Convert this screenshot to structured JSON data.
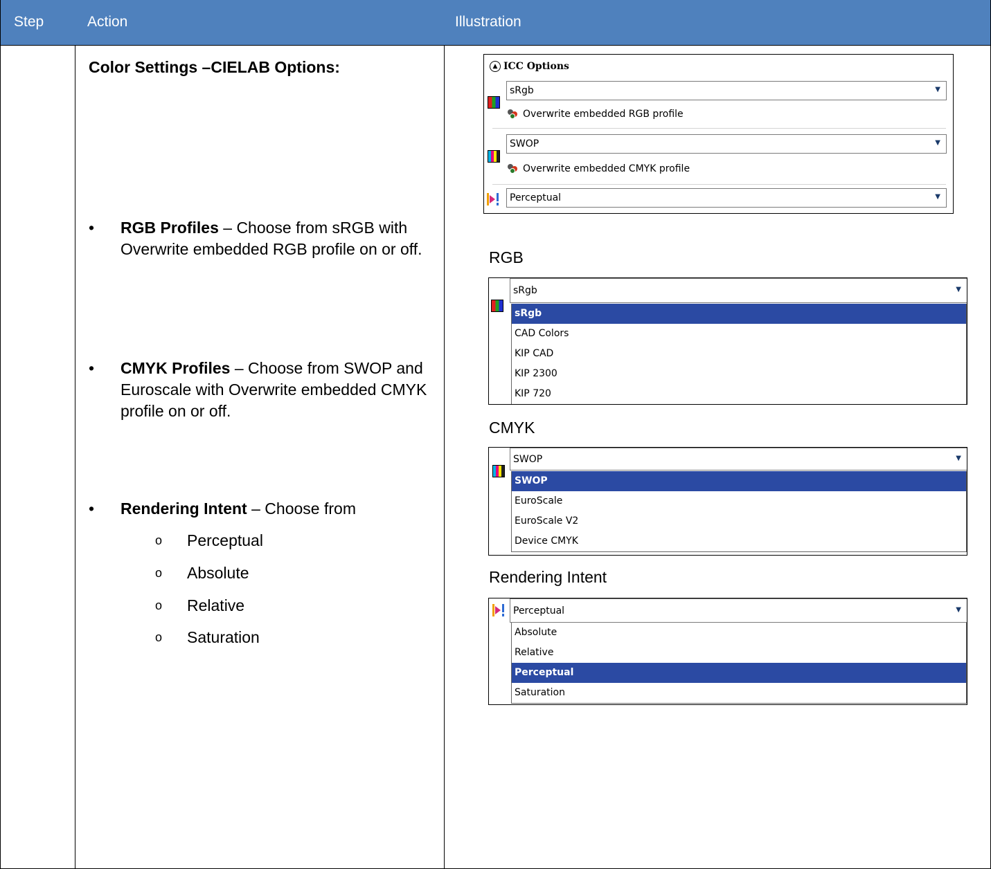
{
  "header": {
    "step": "Step",
    "action": "Action",
    "illustration": "Illustration"
  },
  "action": {
    "title": "Color Settings –CIELAB Options:",
    "rgb": {
      "bold": "RGB Profiles",
      "text": " – Choose from sRGB with Overwrite embedded RGB profile on or off."
    },
    "cmyk": {
      "bold": "CMYK Profiles",
      "text": " – Choose from SWOP and Euroscale with Overwrite embedded CMYK profile on or off."
    },
    "intent": {
      "bold": "Rendering Intent",
      "text": " – Choose from"
    },
    "intent_options": [
      "Perceptual",
      "Absolute",
      "Relative",
      "Saturation"
    ],
    "bullet_glyph": "•",
    "sub_glyph": "o"
  },
  "icc_panel": {
    "title": "ICC Options",
    "rgb_value": "sRgb",
    "rgb_overwrite": "Overwrite embedded RGB profile",
    "cmyk_value": "SWOP",
    "cmyk_overwrite": "Overwrite embedded CMYK profile",
    "intent_value": "Perceptual"
  },
  "rgb_dropdown": {
    "caption": "RGB",
    "value": "sRgb",
    "options": [
      "sRgb",
      "CAD Colors",
      "KIP CAD",
      "KIP 2300",
      "KIP 720"
    ],
    "selected": "sRgb"
  },
  "cmyk_dropdown": {
    "caption": "CMYK",
    "value": "SWOP",
    "options": [
      "SWOP",
      "EuroScale",
      "EuroScale V2",
      "Device CMYK"
    ],
    "selected": "SWOP"
  },
  "intent_dropdown": {
    "caption": "Rendering Intent",
    "value": "Perceptual",
    "options": [
      "Absolute",
      "Relative",
      "Perceptual",
      "Saturation"
    ],
    "selected": "Perceptual"
  },
  "colors": {
    "header_bg": "#4f81bd",
    "selection": "#2b4aa3"
  },
  "icons": {
    "collapse": "chevron-up-circle-icon",
    "dropdown": "chevron-down-icon"
  }
}
